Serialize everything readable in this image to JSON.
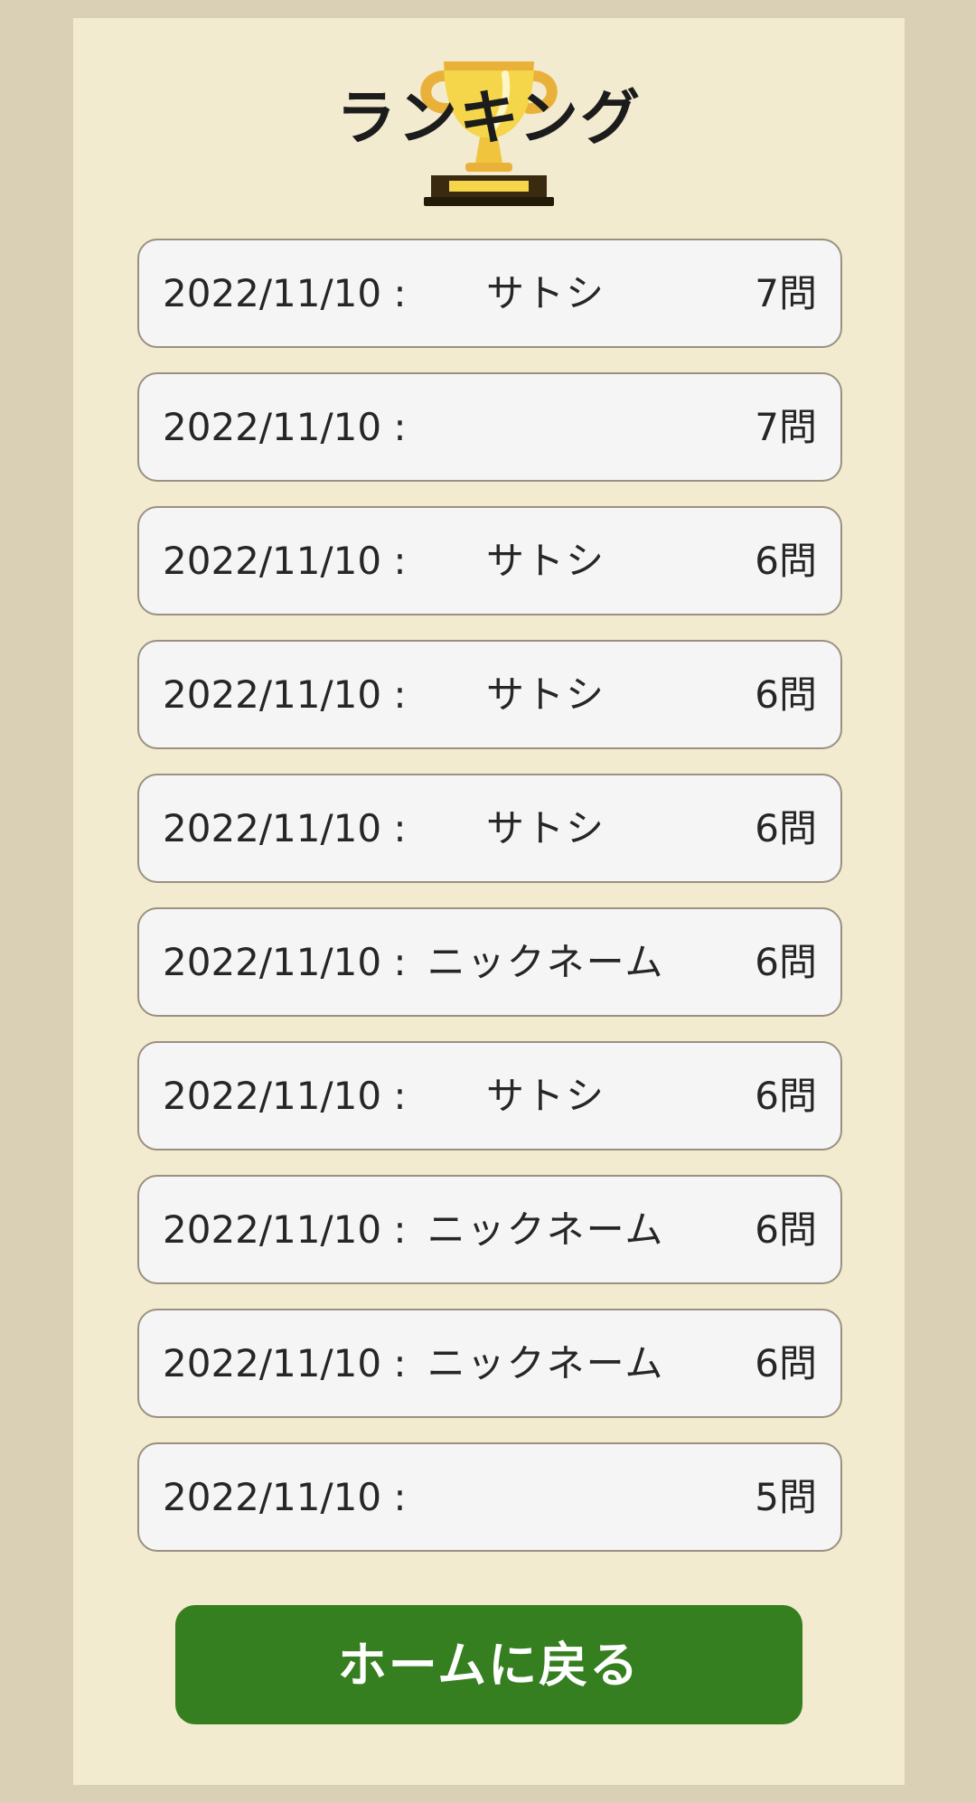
{
  "header": {
    "title": "ランキング",
    "icon": "trophy-icon"
  },
  "rankings": [
    {
      "date": "2022/11/10 :",
      "name": "サトシ",
      "score": "7問"
    },
    {
      "date": "2022/11/10 :",
      "name": "",
      "score": "7問"
    },
    {
      "date": "2022/11/10 :",
      "name": "サトシ",
      "score": "6問"
    },
    {
      "date": "2022/11/10 :",
      "name": "サトシ",
      "score": "6問"
    },
    {
      "date": "2022/11/10 :",
      "name": "サトシ",
      "score": "6問"
    },
    {
      "date": "2022/11/10 :",
      "name": "ニックネーム",
      "score": "6問"
    },
    {
      "date": "2022/11/10 :",
      "name": "サトシ",
      "score": "6問"
    },
    {
      "date": "2022/11/10 :",
      "name": "ニックネーム",
      "score": "6問"
    },
    {
      "date": "2022/11/10 :",
      "name": "ニックネーム",
      "score": "6問"
    },
    {
      "date": "2022/11/10 :",
      "name": "",
      "score": "5問"
    }
  ],
  "footer": {
    "home_button_label": "ホームに戻る"
  },
  "colors": {
    "background": "#d9d0b5",
    "panel": "#f3ebcf",
    "row_background": "#f5f5f5",
    "row_border": "#9a9082",
    "button": "#367f20",
    "trophy_gold": "#f2c33a"
  }
}
